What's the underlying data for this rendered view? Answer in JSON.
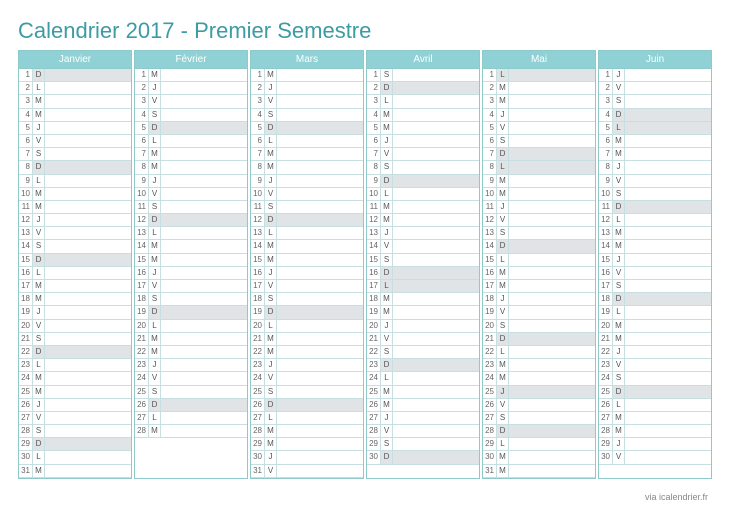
{
  "title": "Calendrier 2017 - Premier Semestre",
  "footer": "via icalendrier.fr",
  "dow": [
    "L",
    "M",
    "M",
    "J",
    "V",
    "S",
    "D"
  ],
  "months": [
    {
      "name": "Janvier",
      "days": 31,
      "start": 7,
      "shaded": [
        1,
        8,
        15,
        22,
        29
      ]
    },
    {
      "name": "Février",
      "days": 28,
      "start": 3,
      "shaded": [
        5,
        12,
        19,
        26
      ]
    },
    {
      "name": "Mars",
      "days": 31,
      "start": 3,
      "shaded": [
        5,
        12,
        19,
        26
      ]
    },
    {
      "name": "Avril",
      "days": 30,
      "start": 6,
      "shaded": [
        2,
        9,
        16,
        17,
        23,
        30
      ]
    },
    {
      "name": "Mai",
      "days": 31,
      "start": 1,
      "shaded": [
        1,
        7,
        8,
        14,
        21,
        25,
        28
      ]
    },
    {
      "name": "Juin",
      "days": 30,
      "start": 4,
      "shaded": [
        4,
        5,
        11,
        18,
        25
      ]
    }
  ]
}
